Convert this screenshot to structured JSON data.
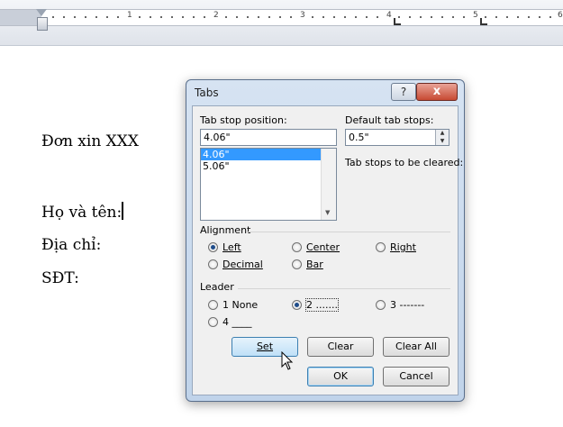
{
  "ruler": {
    "numbers": [
      "1",
      "2",
      "3",
      "4",
      "5",
      "6"
    ]
  },
  "document": {
    "lines": [
      "Đơn xin XXX",
      "Họ và tên:",
      "Địa chỉ:",
      "SĐT:"
    ]
  },
  "dialog": {
    "title": "Tabs",
    "help_label": "?",
    "close_label": "x",
    "tab_stop_position_label": "Tab stop position:",
    "tab_stop_position_value": "4.06\"",
    "tab_stop_list": [
      "4.06\"",
      "5.06\""
    ],
    "default_tab_stops_label": "Default tab stops:",
    "default_tab_stops_value": "0.5\"",
    "tab_stops_cleared_label": "Tab stops to be cleared:",
    "alignment_label": "Alignment",
    "alignment_options": [
      "Left",
      "Center",
      "Right",
      "Decimal",
      "Bar"
    ],
    "alignment_selected": "Left",
    "leader_label": "Leader",
    "leader_options": [
      "1 None",
      "2 .......",
      "3 -------",
      "4 ____"
    ],
    "leader_selected": "2 .......",
    "buttons": {
      "set": "Set",
      "clear": "Clear",
      "clear_all": "Clear All",
      "ok": "OK",
      "cancel": "Cancel"
    }
  }
}
